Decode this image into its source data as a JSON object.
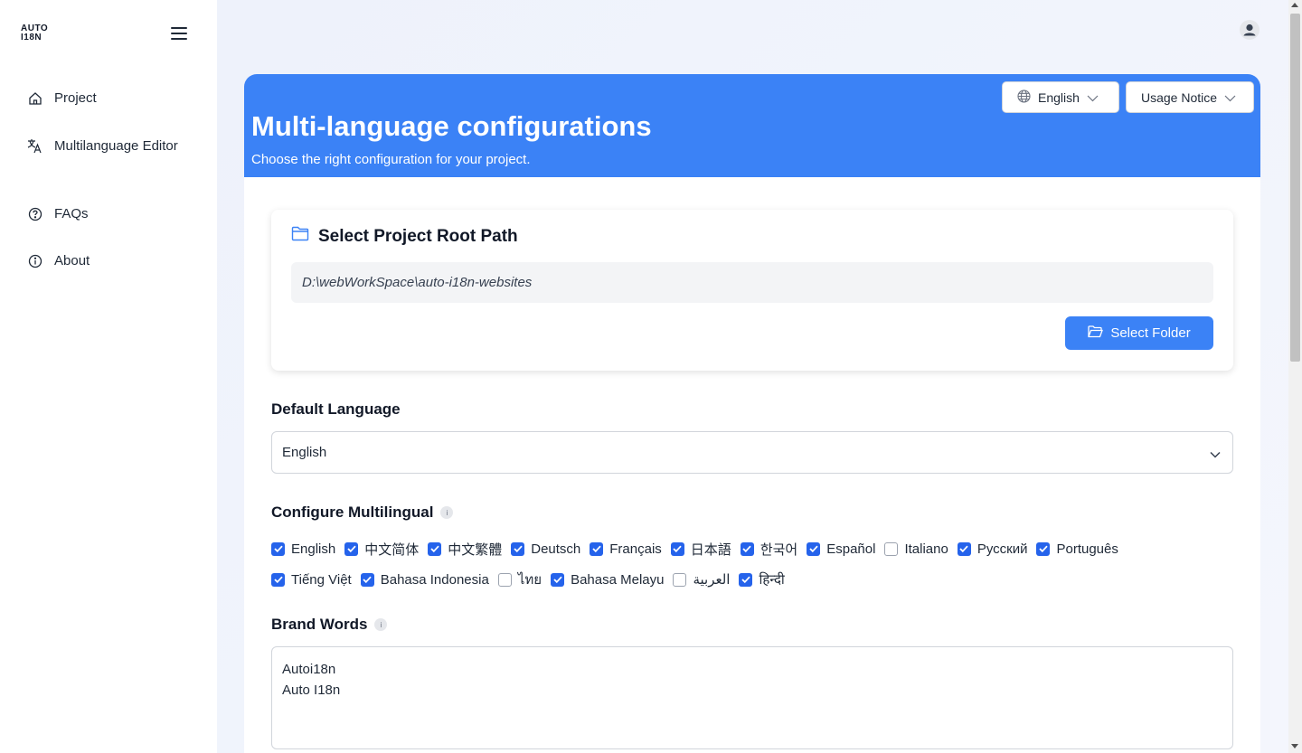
{
  "brand": {
    "logo_line1": "AUTO",
    "logo_line2": "I18N"
  },
  "sidebar": {
    "items": [
      {
        "label": "Project",
        "icon": "home-icon"
      },
      {
        "label": "Multilanguage Editor",
        "icon": "translate-icon"
      },
      {
        "label": "FAQs",
        "icon": "question-circle-icon"
      },
      {
        "label": "About",
        "icon": "info-circle-icon"
      }
    ]
  },
  "header": {
    "avatar_icon": "user-avatar-icon"
  },
  "banner": {
    "title": "Multi-language configurations",
    "subtitle": "Choose the right configuration for your project.",
    "language_dropdown": "English",
    "notice_dropdown": "Usage Notice"
  },
  "project_root": {
    "title": "Select Project Root Path",
    "path": "D:\\webWorkSpace\\auto-i18n-websites",
    "button": "Select Folder"
  },
  "default_language": {
    "label": "Default Language",
    "value": "English"
  },
  "configure_multilingual": {
    "label": "Configure Multilingual",
    "languages": [
      {
        "name": "English",
        "checked": true
      },
      {
        "name": "中文简体",
        "checked": true
      },
      {
        "name": "中文繁體",
        "checked": true
      },
      {
        "name": "Deutsch",
        "checked": true
      },
      {
        "name": "Français",
        "checked": true
      },
      {
        "name": "日本語",
        "checked": true
      },
      {
        "name": "한국어",
        "checked": true
      },
      {
        "name": "Español",
        "checked": true
      },
      {
        "name": "Italiano",
        "checked": false
      },
      {
        "name": "Русский",
        "checked": true
      },
      {
        "name": "Português",
        "checked": true
      },
      {
        "name": "Tiếng Việt",
        "checked": true
      },
      {
        "name": "Bahasa Indonesia",
        "checked": true
      },
      {
        "name": "ไทย",
        "checked": false
      },
      {
        "name": "Bahasa Melayu",
        "checked": true
      },
      {
        "name": "العربية",
        "checked": false
      },
      {
        "name": "हिन्दी",
        "checked": true
      }
    ]
  },
  "brand_words": {
    "label": "Brand Words",
    "value": "Autoi18n\nAuto I18n"
  },
  "colors": {
    "accent": "#3b82f6",
    "checkbox": "#2563eb"
  }
}
